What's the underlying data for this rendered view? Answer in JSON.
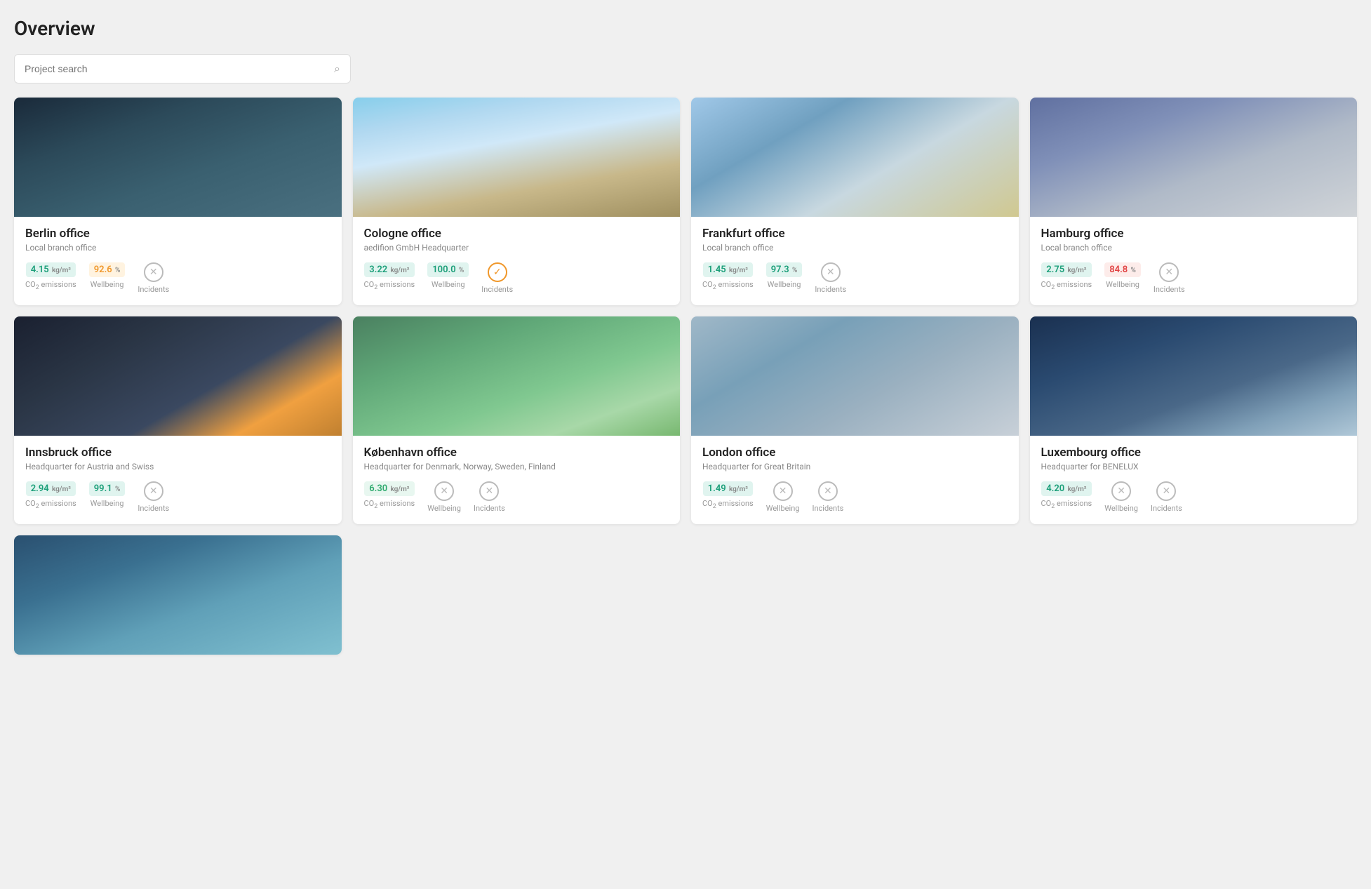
{
  "page": {
    "title": "Overview"
  },
  "search": {
    "placeholder": "Project search"
  },
  "cards": [
    {
      "id": "berlin",
      "title": "Berlin office",
      "subtitle": "Local branch office",
      "imgClass": "img-berlin",
      "co2": "4.15",
      "co2Unit": "kg/m²",
      "co2BadgeClass": "badge-teal",
      "wellbeing": "92.6",
      "wellbeingUnit": "%",
      "wellbeingBadgeClass": "badge-orange",
      "incidents": "circle",
      "incidentIconClass": ""
    },
    {
      "id": "cologne",
      "title": "Cologne office",
      "subtitle": "aedifion GmbH Headquarter",
      "imgClass": "img-cologne",
      "co2": "3.22",
      "co2Unit": "kg/m²",
      "co2BadgeClass": "badge-teal",
      "wellbeing": "100.0",
      "wellbeingUnit": "%",
      "wellbeingBadgeClass": "badge-teal",
      "incidents": "circle-check",
      "incidentIconClass": "icon-circle-orange"
    },
    {
      "id": "frankfurt",
      "title": "Frankfurt office",
      "subtitle": "Local branch office",
      "imgClass": "img-frankfurt",
      "co2": "1.45",
      "co2Unit": "kg/m²",
      "co2BadgeClass": "badge-teal",
      "wellbeing": "97.3",
      "wellbeingUnit": "%",
      "wellbeingBadgeClass": "badge-teal",
      "incidents": "circle",
      "incidentIconClass": ""
    },
    {
      "id": "hamburg",
      "title": "Hamburg office",
      "subtitle": "Local branch office",
      "imgClass": "img-hamburg",
      "co2": "2.75",
      "co2Unit": "kg/m²",
      "co2BadgeClass": "badge-teal",
      "wellbeing": "84.8",
      "wellbeingUnit": "%",
      "wellbeingBadgeClass": "badge-red",
      "incidents": "circle",
      "incidentIconClass": ""
    },
    {
      "id": "innsbruck",
      "title": "Innsbruck office",
      "subtitle": "Headquarter for Austria and Swiss",
      "imgClass": "img-innsbruck",
      "co2": "2.94",
      "co2Unit": "kg/m²",
      "co2BadgeClass": "badge-teal",
      "wellbeing": "99.1",
      "wellbeingUnit": "%",
      "wellbeingBadgeClass": "badge-teal",
      "incidents": "circle",
      "incidentIconClass": ""
    },
    {
      "id": "kobenhavn",
      "title": "København office",
      "subtitle": "Headquarter for Denmark, Norway, Sweden, Finland",
      "imgClass": "img-kobenhavn",
      "co2": "6.30",
      "co2Unit": "kg/m²",
      "co2BadgeClass": "badge-green",
      "wellbeing": null,
      "wellbeingUnit": null,
      "wellbeingBadgeClass": null,
      "incidents": "circle",
      "incidentIconClass": ""
    },
    {
      "id": "london",
      "title": "London office",
      "subtitle": "Headquarter for Great Britain",
      "imgClass": "img-london",
      "co2": "1.49",
      "co2Unit": "kg/m²",
      "co2BadgeClass": "badge-teal",
      "wellbeing": null,
      "wellbeingUnit": null,
      "wellbeingBadgeClass": null,
      "incidents": "circle",
      "incidentIconClass": ""
    },
    {
      "id": "luxembourg",
      "title": "Luxembourg office",
      "subtitle": "Headquarter for BENELUX",
      "imgClass": "img-luxembourg",
      "co2": "4.20",
      "co2Unit": "kg/m²",
      "co2BadgeClass": "badge-teal",
      "wellbeing": null,
      "wellbeingUnit": null,
      "wellbeingBadgeClass": null,
      "incidents": "circle",
      "incidentIconClass": ""
    }
  ],
  "labels": {
    "co2": "CO₂ emissions",
    "wellbeing": "Wellbeing",
    "incidents": "Incidents"
  }
}
